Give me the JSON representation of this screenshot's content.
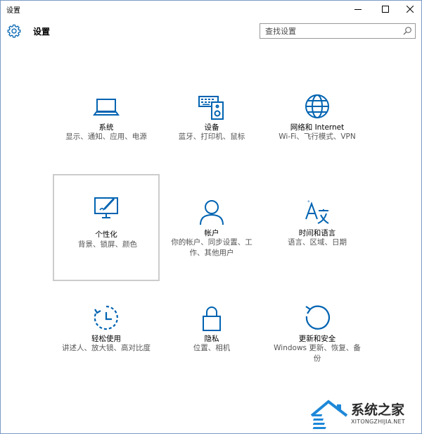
{
  "window": {
    "title": "设置"
  },
  "header": {
    "title": "设置",
    "search_placeholder": "查找设置"
  },
  "tiles": [
    {
      "title": "系统",
      "desc": "显示、通知、应用、电源",
      "icon": "laptop-icon"
    },
    {
      "title": "设备",
      "desc": "蓝牙、打印机、鼠标",
      "icon": "devices-icon"
    },
    {
      "title": "网络和 Internet",
      "desc": "Wi-Fi、飞行模式、VPN",
      "icon": "globe-icon"
    },
    {
      "title": "个性化",
      "desc": "背景、锁屏、颜色",
      "icon": "personalization-icon"
    },
    {
      "title": "帐户",
      "desc": "你的帐户、同步设置、工作、其他用户",
      "icon": "person-icon"
    },
    {
      "title": "时间和语言",
      "desc": "语言、区域、日期",
      "icon": "time-language-icon"
    },
    {
      "title": "轻松使用",
      "desc": "讲述人、放大镜、高对比度",
      "icon": "ease-of-access-icon"
    },
    {
      "title": "隐私",
      "desc": "位置、相机",
      "icon": "lock-icon"
    },
    {
      "title": "更新和安全",
      "desc": "Windows 更新、恢复、备份",
      "icon": "update-icon"
    }
  ],
  "watermark": {
    "text": "系统之家",
    "url": "XITONGZHIJIA.NET"
  },
  "colors": {
    "accent": "#0063b1",
    "selected_border": "#cccccc"
  }
}
